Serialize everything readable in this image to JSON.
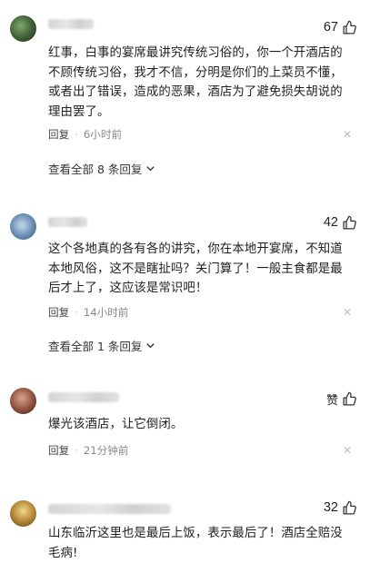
{
  "comments": [
    {
      "likes": "67",
      "text": "红事，白事的宴席最讲究传统习俗的，你一个开酒店的不顾传统习俗，我才不信，分明是你们的上菜员不懂，或者出了错误，造成的恶果，酒店为了避免损失胡说的理由罢了。",
      "reply_label": "回复",
      "time": "6小时前",
      "view_all": "查看全部 8 条回复"
    },
    {
      "likes": "42",
      "text": "这个各地真的各有各的讲究，你在本地开宴席，不知道本地风俗，这不是瞎扯吗？关门算了！一般主食都是最后才上了，这应该是常识吧！",
      "reply_label": "回复",
      "time": "14小时前",
      "view_all": "查看全部 1 条回复"
    },
    {
      "likes": "赞",
      "text": "爆光该酒店，让它倒闭。",
      "reply_label": "回复",
      "time": "21分钟前"
    },
    {
      "likes": "32",
      "text": "山东临沂这里也是最后上饭，表示最后了！酒店全赔没毛病!"
    }
  ],
  "icons": {
    "like": "thumbs-up-icon",
    "close": "close-icon",
    "expand": "chevron-down-icon"
  },
  "colors": {
    "text": "#1f1f1f",
    "meta": "#888888",
    "background": "#ffffff"
  }
}
